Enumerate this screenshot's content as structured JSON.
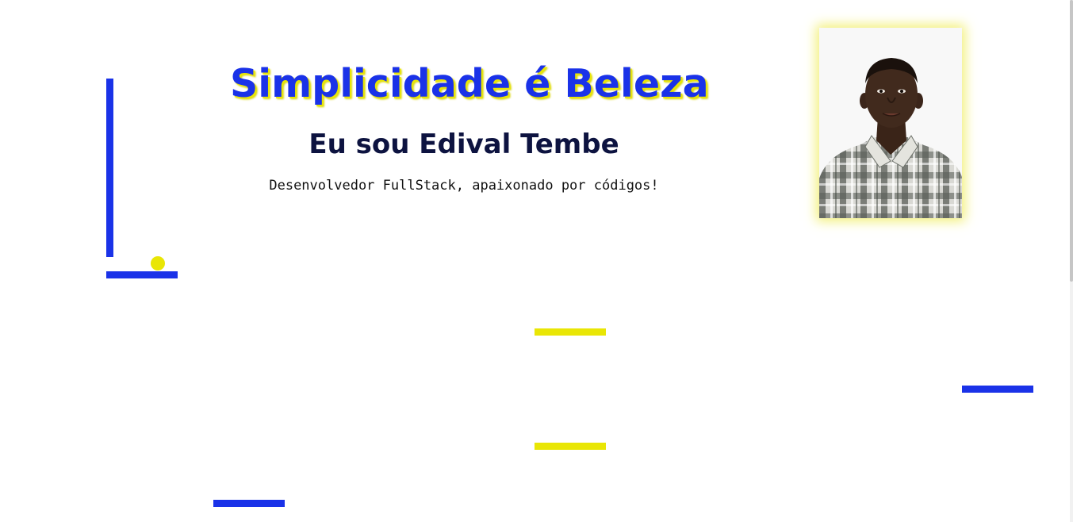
{
  "hero": {
    "title": "Simplicidade é Beleza",
    "subtitle": "Eu sou Edival Tembe",
    "tagline": "Desenvolvedor FullStack, apaixonado por códigos!"
  },
  "colors": {
    "primary_blue": "#1a32e8",
    "accent_yellow": "#e9e605",
    "subtitle_navy": "#0d1340",
    "background": "#ffffff"
  }
}
